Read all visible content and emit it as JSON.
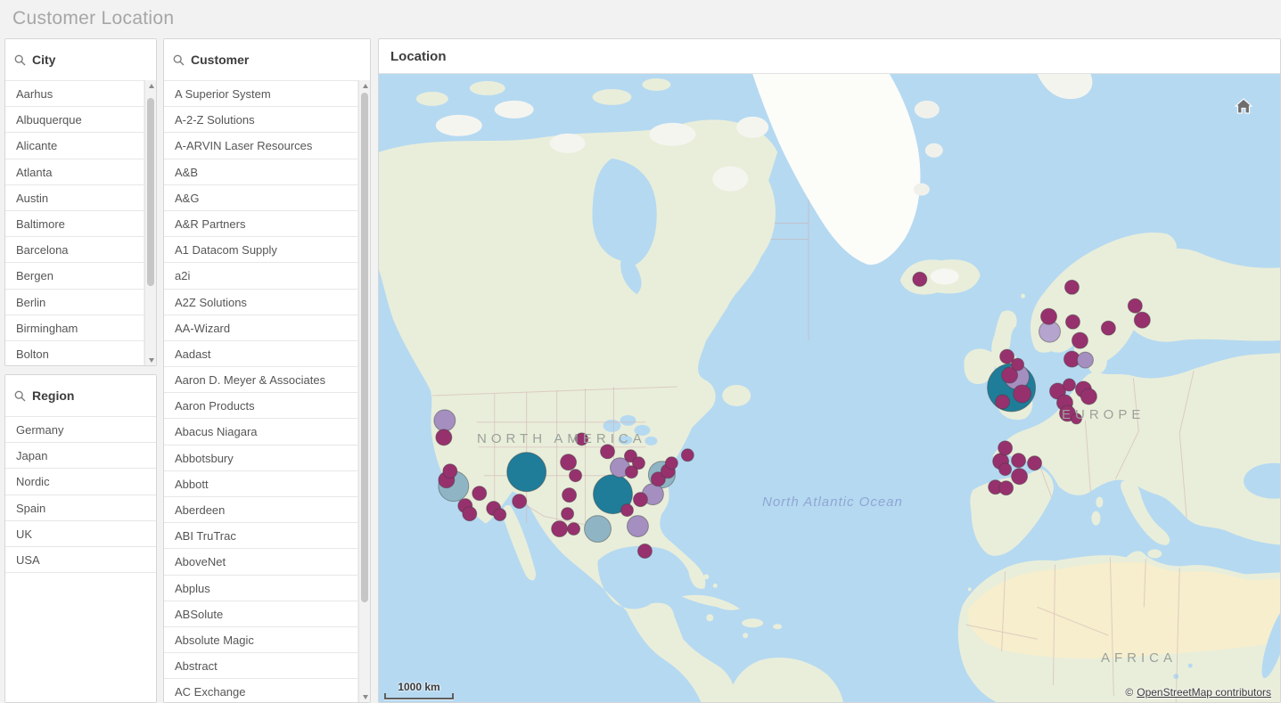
{
  "page": {
    "title": "Customer Location"
  },
  "panels": {
    "city": {
      "title": "City",
      "items": [
        "Aarhus",
        "Albuquerque",
        "Alicante",
        "Atlanta",
        "Austin",
        "Baltimore",
        "Barcelona",
        "Bergen",
        "Berlin",
        "Birmingham",
        "Bolton"
      ]
    },
    "region": {
      "title": "Region",
      "items": [
        "Germany",
        "Japan",
        "Nordic",
        "Spain",
        "UK",
        "USA"
      ]
    },
    "customer": {
      "title": "Customer",
      "items": [
        "A Superior System",
        "A-2-Z Solutions",
        "A-ARVIN Laser Resources",
        "A&B",
        "A&G",
        "A&R Partners",
        "A1 Datacom Supply",
        "a2i",
        "A2Z Solutions",
        "AA-Wizard",
        "Aadast",
        "Aaron D. Meyer & Associates",
        "Aaron Products",
        "Abacus Niagara",
        "Abbotsbury",
        "Abbott",
        "Aberdeen",
        "ABI TruTrac",
        "AboveNet",
        "Abplus",
        "ABSolute",
        "Absolute Magic",
        "Abstract",
        "AC Exchange"
      ]
    },
    "location": {
      "title": "Location",
      "map": {
        "labels": {
          "north_america": "NORTH AMERICA",
          "europe": "EUROPE",
          "africa": "AFRICA",
          "ocean": "North Atlantic Ocean"
        },
        "scale": "1000 km",
        "attribution": {
          "prefix": "©",
          "link": "OpenStreetMap contributors"
        },
        "colors": {
          "teal": "#1f7d99",
          "steel": "#8fb5c5",
          "lavender": "#a48fc0",
          "light_lavender": "#b4a4ce",
          "magenta": "#97316e"
        },
        "bubble_border": "rgba(60,60,60,0.45)",
        "bubbles_xyrc": [
          [
            74,
            390,
            12,
            "lavender"
          ],
          [
            73,
            409,
            9,
            "magenta"
          ],
          [
            80,
            447,
            8,
            "magenta"
          ],
          [
            76,
            457,
            9,
            "magenta"
          ],
          [
            84,
            464,
            17,
            "steel"
          ],
          [
            97,
            486,
            8,
            "magenta"
          ],
          [
            102,
            495,
            8,
            "magenta"
          ],
          [
            113,
            472,
            8,
            "magenta"
          ],
          [
            129,
            489,
            8,
            "magenta"
          ],
          [
            136,
            496,
            7,
            "magenta"
          ],
          [
            158,
            481,
            8,
            "magenta"
          ],
          [
            166,
            448,
            22,
            "teal"
          ],
          [
            213,
            437,
            9,
            "magenta"
          ],
          [
            221,
            452,
            7,
            "magenta"
          ],
          [
            228,
            411,
            7,
            "magenta"
          ],
          [
            214,
            474,
            8,
            "magenta"
          ],
          [
            212,
            495,
            7,
            "magenta"
          ],
          [
            203,
            512,
            9,
            "magenta"
          ],
          [
            219,
            512,
            7,
            "magenta"
          ],
          [
            246,
            512,
            15,
            "steel"
          ],
          [
            263,
            473,
            22,
            "teal"
          ],
          [
            257,
            425,
            8,
            "magenta"
          ],
          [
            271,
            443,
            11,
            "lavender"
          ],
          [
            283,
            430,
            7,
            "magenta"
          ],
          [
            292,
            438,
            7,
            "magenta"
          ],
          [
            284,
            448,
            7,
            "magenta"
          ],
          [
            279,
            491,
            7,
            "magenta"
          ],
          [
            294,
            479,
            8,
            "magenta"
          ],
          [
            291,
            509,
            12,
            "lavender"
          ],
          [
            299,
            537,
            8,
            "magenta"
          ],
          [
            318,
            451,
            15,
            "steel"
          ],
          [
            314,
            456,
            8,
            "magenta"
          ],
          [
            325,
            447,
            8,
            "magenta"
          ],
          [
            329,
            438,
            7,
            "magenta"
          ],
          [
            347,
            429,
            7,
            "magenta"
          ],
          [
            308,
            473,
            12,
            "lavender"
          ],
          [
            608,
            231,
            8,
            "magenta"
          ],
          [
            779,
            240,
            8,
            "magenta"
          ],
          [
            753,
            273,
            9,
            "magenta"
          ],
          [
            754,
            290,
            12,
            "light_lavender"
          ],
          [
            780,
            279,
            8,
            "magenta"
          ],
          [
            850,
            261,
            8,
            "magenta"
          ],
          [
            858,
            277,
            9,
            "magenta"
          ],
          [
            820,
            286,
            8,
            "magenta"
          ],
          [
            788,
            300,
            9,
            "magenta"
          ],
          [
            779,
            321,
            9,
            "magenta"
          ],
          [
            794,
            322,
            9,
            "lavender"
          ],
          [
            706,
            318,
            8,
            "magenta"
          ],
          [
            718,
            327,
            7,
            "magenta"
          ],
          [
            711,
            353,
            27,
            "teal"
          ],
          [
            717,
            341,
            14,
            "lavender"
          ],
          [
            709,
            339,
            9,
            "magenta"
          ],
          [
            723,
            360,
            10,
            "magenta"
          ],
          [
            701,
            369,
            8,
            "magenta"
          ],
          [
            763,
            357,
            9,
            "magenta"
          ],
          [
            776,
            350,
            7,
            "magenta"
          ],
          [
            771,
            370,
            9,
            "magenta"
          ],
          [
            792,
            355,
            9,
            "magenta"
          ],
          [
            798,
            363,
            9,
            "magenta"
          ],
          [
            774,
            382,
            9,
            "magenta"
          ],
          [
            784,
            388,
            6,
            "magenta"
          ],
          [
            704,
            421,
            8,
            "magenta"
          ],
          [
            699,
            436,
            9,
            "magenta"
          ],
          [
            719,
            435,
            8,
            "magenta"
          ],
          [
            737,
            438,
            8,
            "magenta"
          ],
          [
            704,
            445,
            7,
            "magenta"
          ],
          [
            720,
            453,
            9,
            "magenta"
          ],
          [
            693,
            465,
            8,
            "magenta"
          ],
          [
            705,
            466,
            8,
            "magenta"
          ]
        ]
      }
    }
  }
}
